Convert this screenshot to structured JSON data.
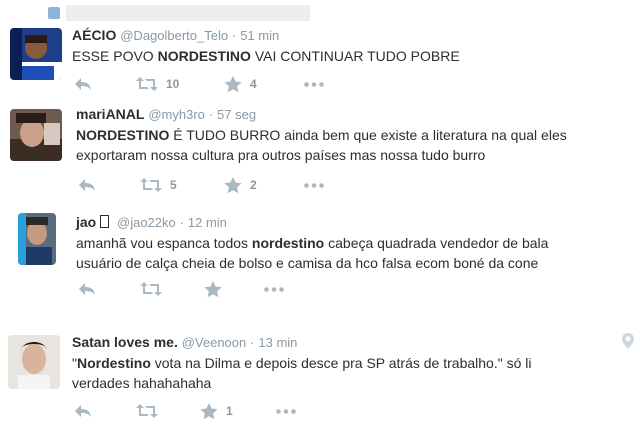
{
  "tweets": [
    {
      "name": "AÉCIO",
      "handle": "@Dagolberto_Telo",
      "time": "51 min",
      "lines": [
        [
          "ESSE POVO ",
          "NORDESTINO",
          " VAI CONTINUAR TUDO POBRE"
        ]
      ],
      "retweets": "10",
      "favorites": "4"
    },
    {
      "name": "mariANAL",
      "handle": "@myh3ro",
      "time": "57 seg",
      "lines": [
        [
          "",
          "NORDESTINO",
          " É TUDO BURRO ainda bem que existe a literatura na qual eles"
        ],
        [
          "exportaram nossa cultura pra outros países mas nossa tudo burro",
          "",
          ""
        ]
      ],
      "retweets": "5",
      "favorites": "2"
    },
    {
      "name": "jao ",
      "handle": "@jao22ko",
      "time": "12 min",
      "lines": [
        [
          "amanhã vou espanca todos ",
          "nordestino",
          " cabeça quadrada vendedor de bala"
        ],
        [
          "usuário de calça cheia de bolso e camisa da hco falsa ecom boné da cone",
          "",
          ""
        ]
      ],
      "retweets": "",
      "favorites": ""
    },
    {
      "name": "Satan loves me.",
      "handle": "@Veenoon",
      "time": "13 min",
      "lines": [
        [
          "\"",
          "Nordestino",
          " vota na Dilma e depois desce pra SP atrás de trabalho.\" só li"
        ],
        [
          "verdades hahahahaha",
          "",
          ""
        ]
      ],
      "retweets": "",
      "favorites": "1"
    }
  ],
  "colors": {
    "name": "#292f33",
    "meta": "#8899a6",
    "icon": "#aab8c2"
  },
  "icons": {
    "reply": "reply-icon",
    "retweet": "retweet-icon",
    "favorite": "star-icon",
    "more": "more-icon",
    "location": "location-pin-icon"
  },
  "separator": "·"
}
